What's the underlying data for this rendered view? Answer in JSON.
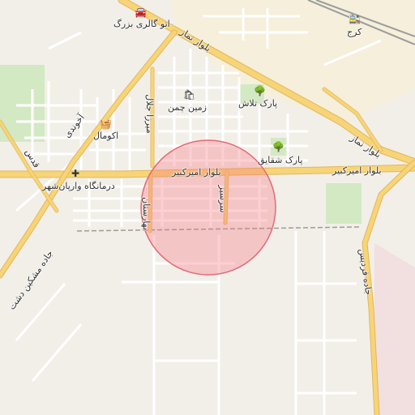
{
  "map": {
    "colors": {
      "background": "#f2efe9",
      "industrial": "#f5efdb",
      "park": "#d3e9c4",
      "road_major": "#f7d477",
      "road_major_casing": "#e1b75c",
      "road_minor": "#ffffff",
      "railway": "#9c9c9c",
      "marker_fill": "#f59aa2",
      "marker_stroke": "#e26b78"
    },
    "marker": {
      "shape": "circle",
      "style": "translucent-red"
    },
    "labels": {
      "boulevard_amirkabir_west": "بلوار امیرکبیر",
      "boulevard_amirkabir_east": "بلوار امیرکبیر",
      "boulevard_namaz_north": "بلوار نماز",
      "boulevard_namaz_east": "بلوار نماز",
      "street_mirza_jelal": "میرزا جلال",
      "street_baharestan": "بهارستان",
      "street_sarsabz": "سرسبز",
      "street_akhondi": "آخوندی",
      "street_qods": "قدس",
      "road_mashkin_dasht": "جاده مشکین دشت",
      "road_fardis": "جاده فردیس",
      "poi_auto_gallery": "اتو گالری بزرگ",
      "poi_zamin_chaman": "زمین چمن",
      "poi_okomal": "اکومال",
      "poi_park_talash": "پارک تلاش",
      "poi_park_shaghayegh": "پارک شقایق",
      "poi_clinic": "درمانگاه وارپان‌شهر",
      "poi_karaj": "کرج"
    },
    "icons": {
      "car": "car-icon",
      "shop": "shop-icon",
      "basket": "basket-icon",
      "tree": "tree-icon",
      "clinic": "medical-cross-icon",
      "train": "train-station-icon"
    }
  }
}
